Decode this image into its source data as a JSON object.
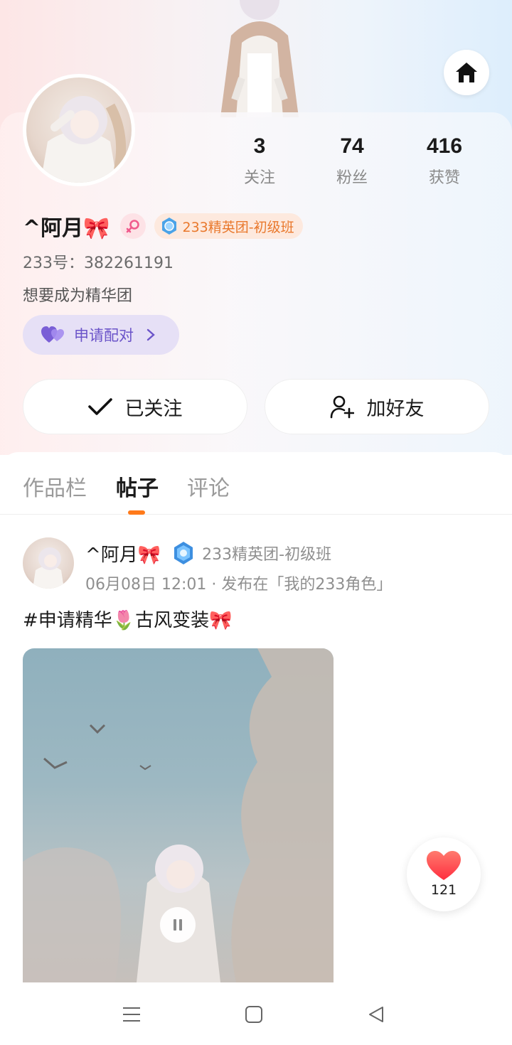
{
  "profile": {
    "username": "^阿月🎀",
    "rank_title": "233精英团-初级班",
    "uid_text": "233号：382261191",
    "bio": "想要成为精华团",
    "pair_button_label": "申请配对",
    "stats": [
      {
        "value": "3",
        "label": "关注"
      },
      {
        "value": "74",
        "label": "粉丝"
      },
      {
        "value": "416",
        "label": "获赞"
      }
    ]
  },
  "actions": {
    "follow_label": "已关注",
    "add_friend_label": "加好友"
  },
  "tabs": [
    {
      "label": "作品栏",
      "active": false
    },
    {
      "label": "帖子",
      "active": true
    },
    {
      "label": "评论",
      "active": false
    }
  ],
  "post": {
    "author": "^阿月🎀",
    "rank_title": "233精英团-初级班",
    "meta": "06月08日 12:01 · 发布在「我的233角色」",
    "title": "#申请精华🌷古风变装🎀"
  },
  "like": {
    "count": "121"
  },
  "icons": {
    "home": "home-icon",
    "gender": "female-icon",
    "rank": "rank-medal-icon",
    "pair": "hearts-icon",
    "follow": "checkmark-icon",
    "add_friend": "add-user-icon",
    "pause": "pause-icon",
    "like": "heart-icon",
    "nav_menu": "menu-icon",
    "nav_home": "square-home-icon",
    "nav_back": "back-triangle-icon"
  },
  "colors": {
    "accent_orange": "#ff7a1a",
    "pair_purple": "#6b54c9",
    "rank_orange": "#e9782c",
    "like_red": "#ff4b4b"
  }
}
